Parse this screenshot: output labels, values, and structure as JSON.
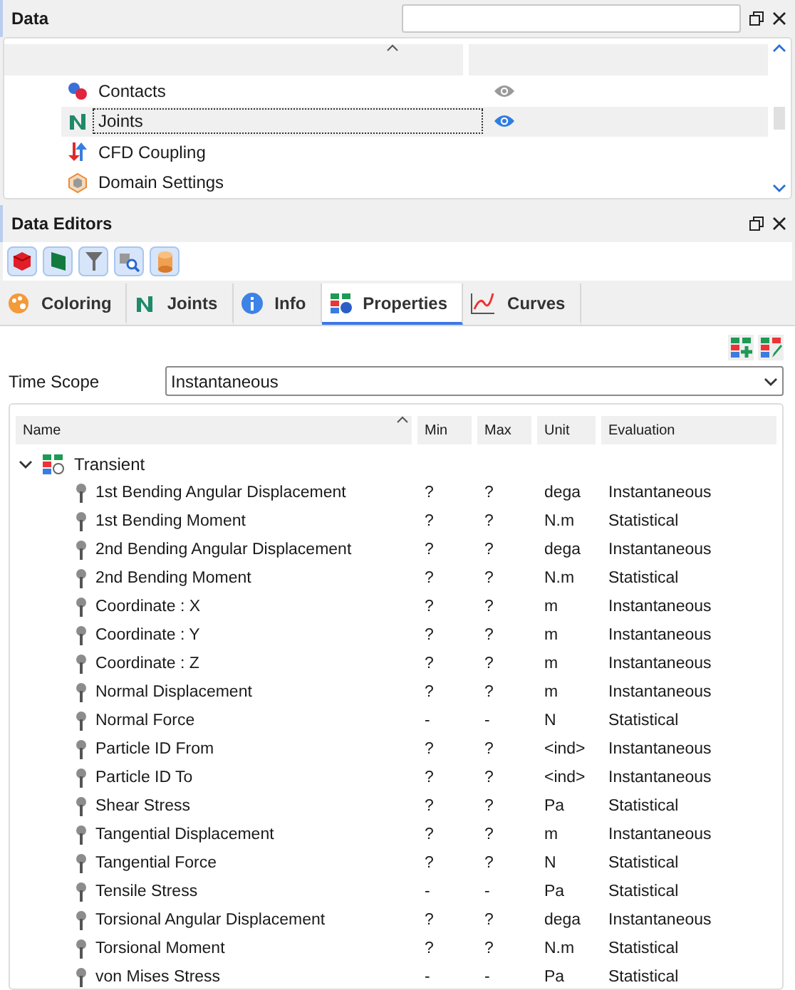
{
  "data_panel": {
    "title": "Data",
    "tree": [
      {
        "label": "Contacts",
        "kind": "contacts",
        "selected": false,
        "eye_highlighted": false
      },
      {
        "label": "Joints",
        "kind": "joints",
        "selected": true,
        "eye_highlighted": true
      },
      {
        "label": "CFD Coupling",
        "kind": "cfd",
        "selected": false
      },
      {
        "label": "Domain Settings",
        "kind": "domain",
        "selected": false
      }
    ]
  },
  "editors_panel": {
    "title": "Data Editors",
    "toolbar": [
      {
        "kind": "cube"
      },
      {
        "kind": "panel"
      },
      {
        "kind": "funnel"
      },
      {
        "kind": "inspect"
      },
      {
        "kind": "cylinder"
      }
    ],
    "tabs": [
      {
        "label": "Coloring",
        "kind": "palette",
        "selected": false
      },
      {
        "label": "Joints",
        "kind": "joints",
        "selected": false
      },
      {
        "label": "Info",
        "kind": "info",
        "selected": false
      },
      {
        "label": "Properties",
        "kind": "grid",
        "selected": true
      },
      {
        "label": "Curves",
        "kind": "curve",
        "selected": false
      }
    ],
    "time_scope": {
      "label": "Time Scope",
      "value": "Instantaneous"
    },
    "table": {
      "columns": [
        "Name",
        "Min",
        "Max",
        "Unit",
        "Evaluation"
      ],
      "group": {
        "label": "Transient",
        "expanded": true,
        "rows": [
          [
            "1st Bending Angular Displacement",
            "?",
            "?",
            "dega",
            "Instantaneous"
          ],
          [
            "1st Bending Moment",
            "?",
            "?",
            "N.m",
            "Statistical"
          ],
          [
            "2nd Bending Angular Displacement",
            "?",
            "?",
            "dega",
            "Instantaneous"
          ],
          [
            "2nd Bending Moment",
            "?",
            "?",
            "N.m",
            "Statistical"
          ],
          [
            "Coordinate : X",
            "?",
            "?",
            "m",
            "Instantaneous"
          ],
          [
            "Coordinate : Y",
            "?",
            "?",
            "m",
            "Instantaneous"
          ],
          [
            "Coordinate : Z",
            "?",
            "?",
            "m",
            "Instantaneous"
          ],
          [
            "Normal Displacement",
            "?",
            "?",
            "m",
            "Instantaneous"
          ],
          [
            "Normal Force",
            "-",
            "-",
            "N",
            "Statistical"
          ],
          [
            "Particle ID From",
            "?",
            "?",
            "<ind>",
            "Instantaneous"
          ],
          [
            "Particle ID To",
            "?",
            "?",
            "<ind>",
            "Instantaneous"
          ],
          [
            "Shear Stress",
            "?",
            "?",
            "Pa",
            "Statistical"
          ],
          [
            "Tangential Displacement",
            "?",
            "?",
            "m",
            "Instantaneous"
          ],
          [
            "Tangential Force",
            "?",
            "?",
            "N",
            "Statistical"
          ],
          [
            "Tensile Stress",
            "-",
            "-",
            "Pa",
            "Statistical"
          ],
          [
            "Torsional Angular Displacement",
            "?",
            "?",
            "dega",
            "Instantaneous"
          ],
          [
            "Torsional Moment",
            "?",
            "?",
            "N.m",
            "Statistical"
          ],
          [
            "von Mises Stress",
            "-",
            "-",
            "Pa",
            "Statistical"
          ]
        ]
      }
    }
  }
}
